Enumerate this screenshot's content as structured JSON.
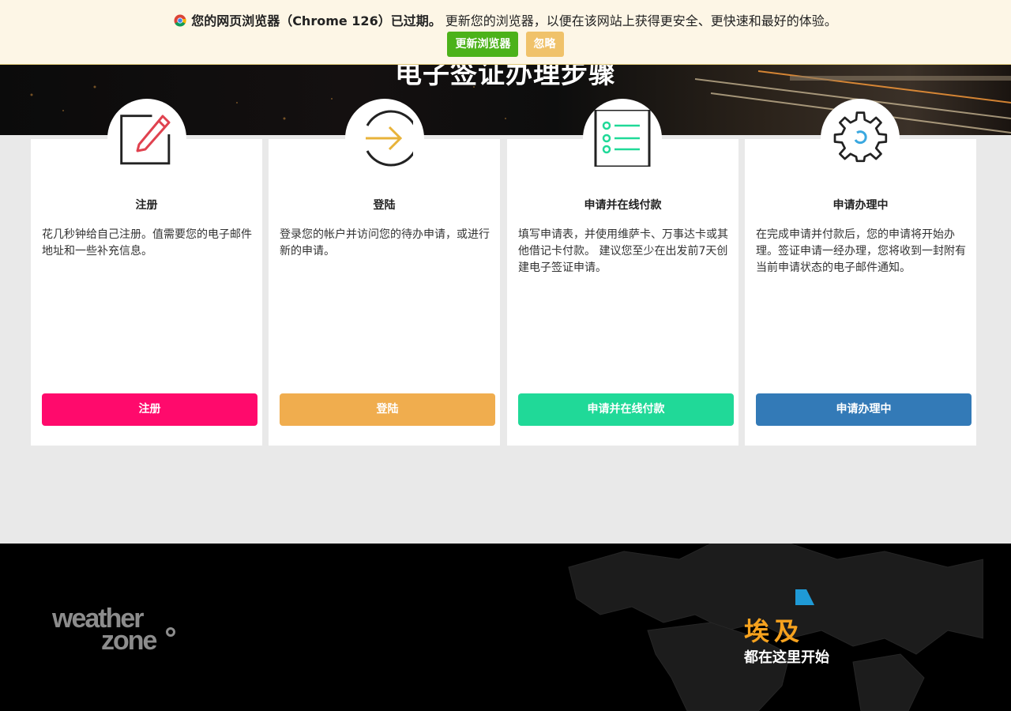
{
  "update_bar": {
    "message_bold": "您的网页浏览器（Chrome 126）已过期。",
    "message_rest": " 更新您的浏览器，以便在该网站上获得更安全、更快速和最好的体验。",
    "update_button": "更新浏览器",
    "ignore_button": "忽略"
  },
  "hero": {
    "title": "电子签证办理步骤"
  },
  "steps": [
    {
      "title": "注册",
      "desc": "花几秒钟给自己注册。值需要您的电子邮件地址和一些补充信息。",
      "button": "注册",
      "color": "#ff0a6c",
      "icon": "pencil-icon"
    },
    {
      "title": "登陆",
      "desc": "登录您的帐户并访问您的待办申请，或进行新的申请。",
      "button": "登陆",
      "color": "#f0ad4e",
      "icon": "arrow-right-icon"
    },
    {
      "title": "申请并在线付款",
      "desc": "填写申请表，并使用维萨卡、万事达卡或其他借记卡付款。 建议您至少在出发前7天创建电子签证申请。",
      "button": "申请并在线付款",
      "color": "#20d998",
      "icon": "list-icon"
    },
    {
      "title": "申请办理中",
      "desc": "在完成申请并付款后，您的申请将开始办理。签证申请一经办理，您将收到一封附有当前申请状态的电子邮件通知。",
      "button": "申请办理中",
      "color": "#337ab7",
      "icon": "gear-icon"
    }
  ],
  "footer": {
    "logo_line1": "weather",
    "logo_line2": "zone",
    "country": "埃及",
    "tagline": "都在这里开始"
  }
}
